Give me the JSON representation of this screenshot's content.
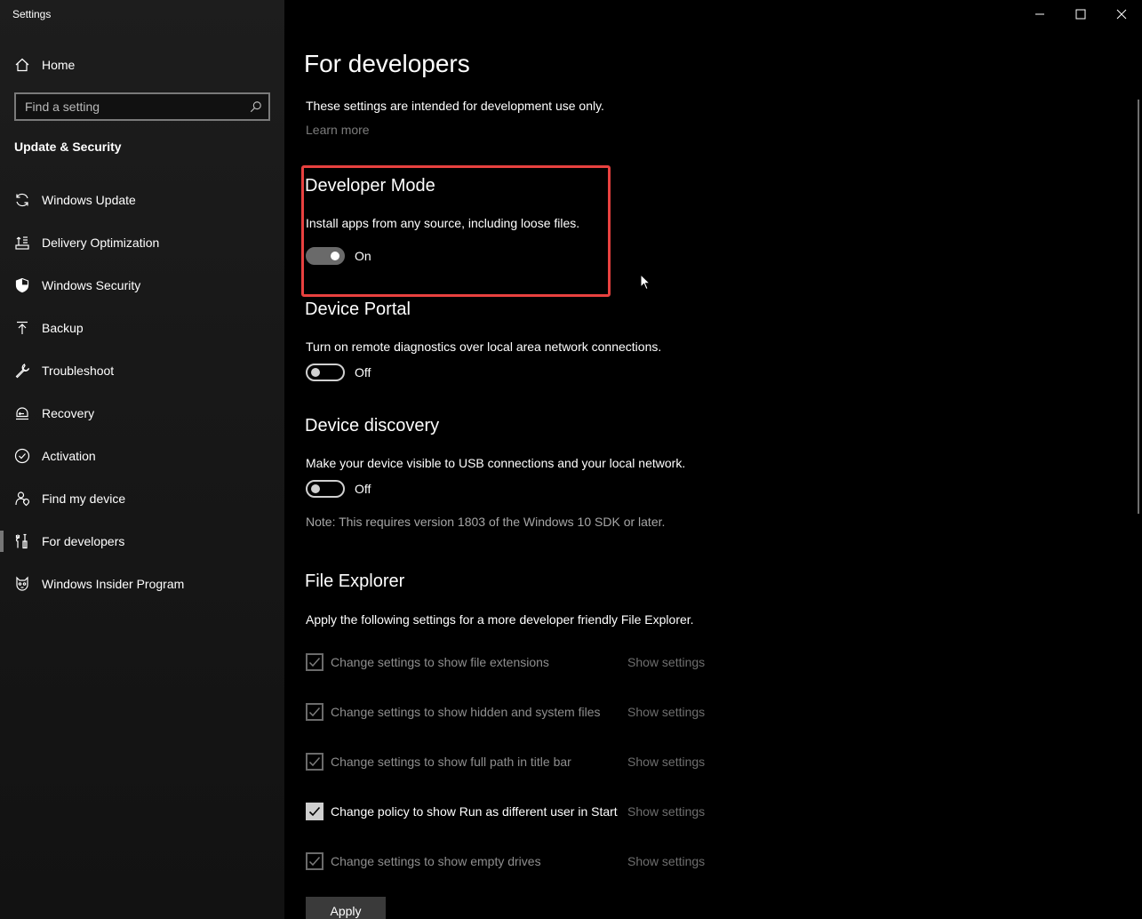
{
  "window": {
    "title": "Settings",
    "controls": {
      "minimize": "minimize-icon",
      "maximize": "maximize-icon",
      "close": "close-icon"
    }
  },
  "sidebar": {
    "home_label": "Home",
    "search_placeholder": "Find a setting",
    "section_title": "Update & Security",
    "items": [
      {
        "label": "Windows Update",
        "icon": "refresh-icon"
      },
      {
        "label": "Delivery Optimization",
        "icon": "delivery-optimization-icon"
      },
      {
        "label": "Windows Security",
        "icon": "shield-icon"
      },
      {
        "label": "Backup",
        "icon": "backup-arrow-icon"
      },
      {
        "label": "Troubleshoot",
        "icon": "wrench-icon"
      },
      {
        "label": "Recovery",
        "icon": "recovery-icon"
      },
      {
        "label": "Activation",
        "icon": "check-circle-icon"
      },
      {
        "label": "Find my device",
        "icon": "person-pin-icon"
      },
      {
        "label": "For developers",
        "icon": "developer-tools-icon"
      },
      {
        "label": "Windows Insider Program",
        "icon": "insider-cat-icon"
      }
    ],
    "active_item": "For developers"
  },
  "main": {
    "title": "For developers",
    "intro": "These settings are intended for development use only.",
    "learn_more": "Learn more",
    "developer_mode": {
      "heading": "Developer Mode",
      "description": "Install apps from any source, including loose files.",
      "state": "On"
    },
    "device_portal": {
      "heading": "Device Portal",
      "description": "Turn on remote diagnostics over local area network connections.",
      "state": "Off"
    },
    "device_discovery": {
      "heading": "Device discovery",
      "description": "Make your device visible to USB connections and your local network.",
      "state": "Off",
      "note": "Note: This requires version 1803 of the Windows 10 SDK or later."
    },
    "file_explorer": {
      "heading": "File Explorer",
      "description": "Apply the following settings for a more developer friendly File Explorer.",
      "options": [
        {
          "label": "Change settings to show file extensions",
          "checked": true,
          "link": "Show settings"
        },
        {
          "label": "Change settings to show hidden and system files",
          "checked": true,
          "link": "Show settings"
        },
        {
          "label": "Change settings to show full path in title bar",
          "checked": true,
          "link": "Show settings"
        },
        {
          "label": "Change policy to show Run as different user in Start",
          "checked": true,
          "link": "Show settings"
        },
        {
          "label": "Change settings to show empty drives",
          "checked": true,
          "link": "Show settings"
        }
      ],
      "apply_label": "Apply"
    },
    "colors": {
      "highlight": "#e8413f",
      "accent_toggle_on": "#6a6a6a"
    }
  }
}
